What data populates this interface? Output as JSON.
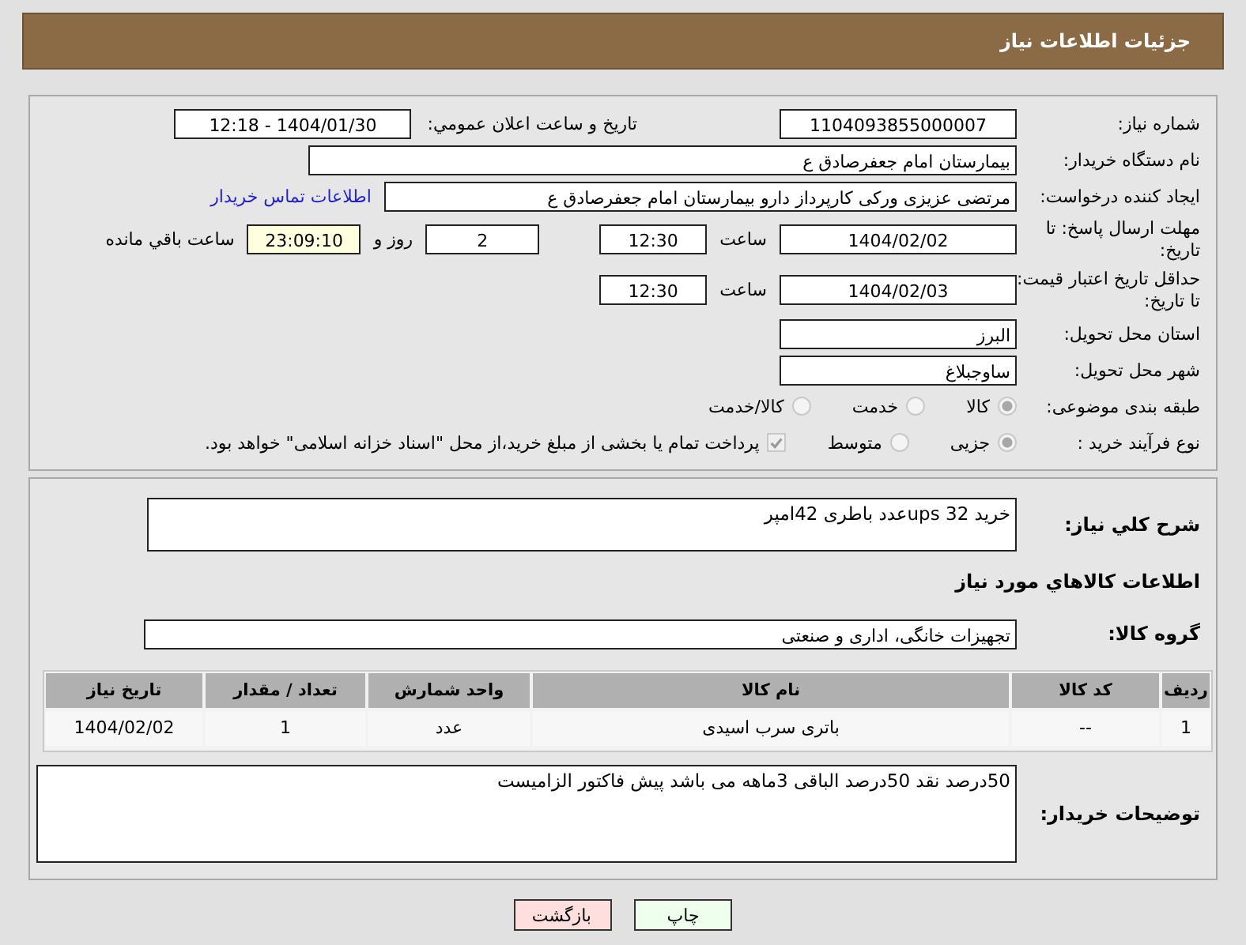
{
  "header": {
    "title": "جزئیات اطلاعات نیاز"
  },
  "need_number": {
    "label": "شماره نیاز:",
    "value": "1104093855000007"
  },
  "announce": {
    "label": "تاریخ و ساعت اعلان عمومي:",
    "value": "1404/01/30 - 12:18"
  },
  "buyer_org": {
    "label": "نام دستگاه خریدار:",
    "value": "بیمارستان امام جعفرصادق ع"
  },
  "creator": {
    "label": "ایجاد کننده درخواست:",
    "value": "مرتضی عزیزی ورکی کارپرداز دارو بیمارستان امام جعفرصادق ع",
    "link": "اطلاعات تماس خریدار"
  },
  "deadline": {
    "label": "مهلت ارسال پاسخ: تا تاریخ:",
    "date": "1404/02/02",
    "time_label": "ساعت",
    "time": "12:30",
    "days": "2",
    "days_label": "روز و",
    "remaining": "23:09:10",
    "remaining_label": "ساعت باقي مانده"
  },
  "price_validity": {
    "label": "حداقل تاریخ اعتبار قیمت: تا تاریخ:",
    "date": "1404/02/03",
    "time_label": "ساعت",
    "time": "12:30"
  },
  "province": {
    "label": "استان محل تحویل:",
    "value": "البرز"
  },
  "city": {
    "label": "شهر محل تحویل:",
    "value": "ساوجبلاغ"
  },
  "category": {
    "label": "طبقه بندی موضوعی:",
    "options": [
      {
        "label": "کالا",
        "selected": true
      },
      {
        "label": "خدمت",
        "selected": false
      },
      {
        "label": "کالا/خدمت",
        "selected": false
      }
    ]
  },
  "process": {
    "label": "نوع فرآیند خرید :",
    "options": [
      {
        "label": "جزیی",
        "selected": true
      },
      {
        "label": "متوسط",
        "selected": false
      }
    ],
    "treasury": {
      "label": "پرداخت تمام یا بخشی از مبلغ خرید،از محل \"اسناد خزانه اسلامی\" خواهد بود.",
      "checked": true
    }
  },
  "description": {
    "label": "شرح کلي نیاز:",
    "value": "خرید ups 32عدد باطری 42امپر"
  },
  "goods_title": "اطلاعات کالاهاي مورد نیاز",
  "goods_group": {
    "label": "گروه کالا:",
    "value": "تجهیزات خانگی، اداری و صنعتی"
  },
  "table": {
    "columns": [
      "ردیف",
      "کد کالا",
      "نام کالا",
      "واحد شمارش",
      "تعداد / مقدار",
      "تاریخ نیاز"
    ],
    "rows": [
      [
        "1",
        "--",
        "باتری سرب اسیدی",
        "عدد",
        "1",
        "1404/02/02"
      ]
    ]
  },
  "buyer_notes": {
    "label": "توضیحات خریدار:",
    "value": "50درصد نقد 50درصد الباقی 3ماهه می باشد پیش فاکتور الزامیست"
  },
  "buttons": [
    {
      "label": "چاپ",
      "kind": "print"
    },
    {
      "label": "بازگشت",
      "kind": "back"
    }
  ]
}
